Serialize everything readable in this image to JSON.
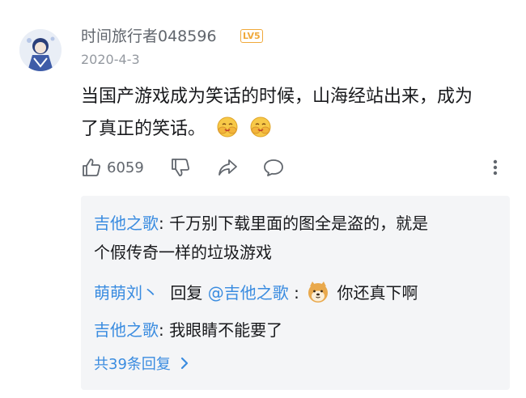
{
  "comment": {
    "username": "时间旅行者048596",
    "level": "LV5",
    "date": "2020-4-3",
    "text_line1": "当国产游戏成为笑话的时候，山海经站出来，成为",
    "text_line2": "了真正的笑话。",
    "emoji_icon": "laugh-cover-face-emoji",
    "like_count": "6059"
  },
  "replies": [
    {
      "author": "吉他之歌",
      "sep": ": ",
      "text": "千万别下载里面的图全是盗的，就是",
      "text2": "个假传奇一样的垃圾游戏"
    },
    {
      "author": "萌萌刘丶",
      "mid": "回复",
      "mention": "@吉他之歌",
      "sep": ":",
      "emoji_icon": "shiba-dog-emoji",
      "text": "你还真下啊"
    },
    {
      "author": "吉他之歌",
      "sep": ": ",
      "text": "我眼睛不能要了"
    }
  ],
  "more_replies_label": "共39条回复",
  "colors": {
    "link_blue": "#3a8ce0",
    "level_orange": "#f0a93b",
    "secondary_text": "#61666d",
    "reply_bg": "#f4f5f7"
  }
}
